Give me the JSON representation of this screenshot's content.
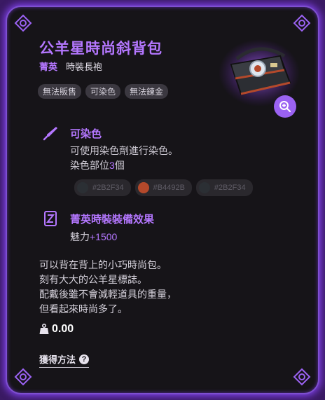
{
  "item": {
    "name": "公羊星時尚斜背包",
    "grade": "菁英",
    "category": "時裝長袍",
    "tags": [
      "無法販售",
      "可染色",
      "無法鍊金"
    ],
    "image_icon": "messenger-bag-icon",
    "zoom_icon": "zoom-in-icon"
  },
  "dye": {
    "icon": "dye-brush-icon",
    "title": "可染色",
    "line1": "可使用染色劑進行染色。",
    "line2_prefix": "染色部位",
    "slot_count": "3",
    "line2_suffix": "個",
    "swatches": [
      {
        "code": "#2B2F34",
        "color": "#2B2F34"
      },
      {
        "code": "#B4492B",
        "color": "#B4492B"
      },
      {
        "code": "#2B2F34",
        "color": "#2B2F34"
      }
    ]
  },
  "effect": {
    "icon": "outfit-effect-icon",
    "title": "菁英時裝裝備效果",
    "stat_label": "魅力",
    "stat_value": "+1500"
  },
  "description": "可以背在背上的小巧時尚包。\n刻有大大的公羊星標誌。\n配戴後雖不會減輕道具的重量，\n但看起來時尚多了。",
  "weight": {
    "icon": "weight-icon",
    "value": "0.00"
  },
  "obtain": {
    "label": "獲得方法",
    "help_icon": "question-icon"
  },
  "colors": {
    "accent": "#b477ff",
    "background": "#161418",
    "border": "#7e4fd0"
  }
}
